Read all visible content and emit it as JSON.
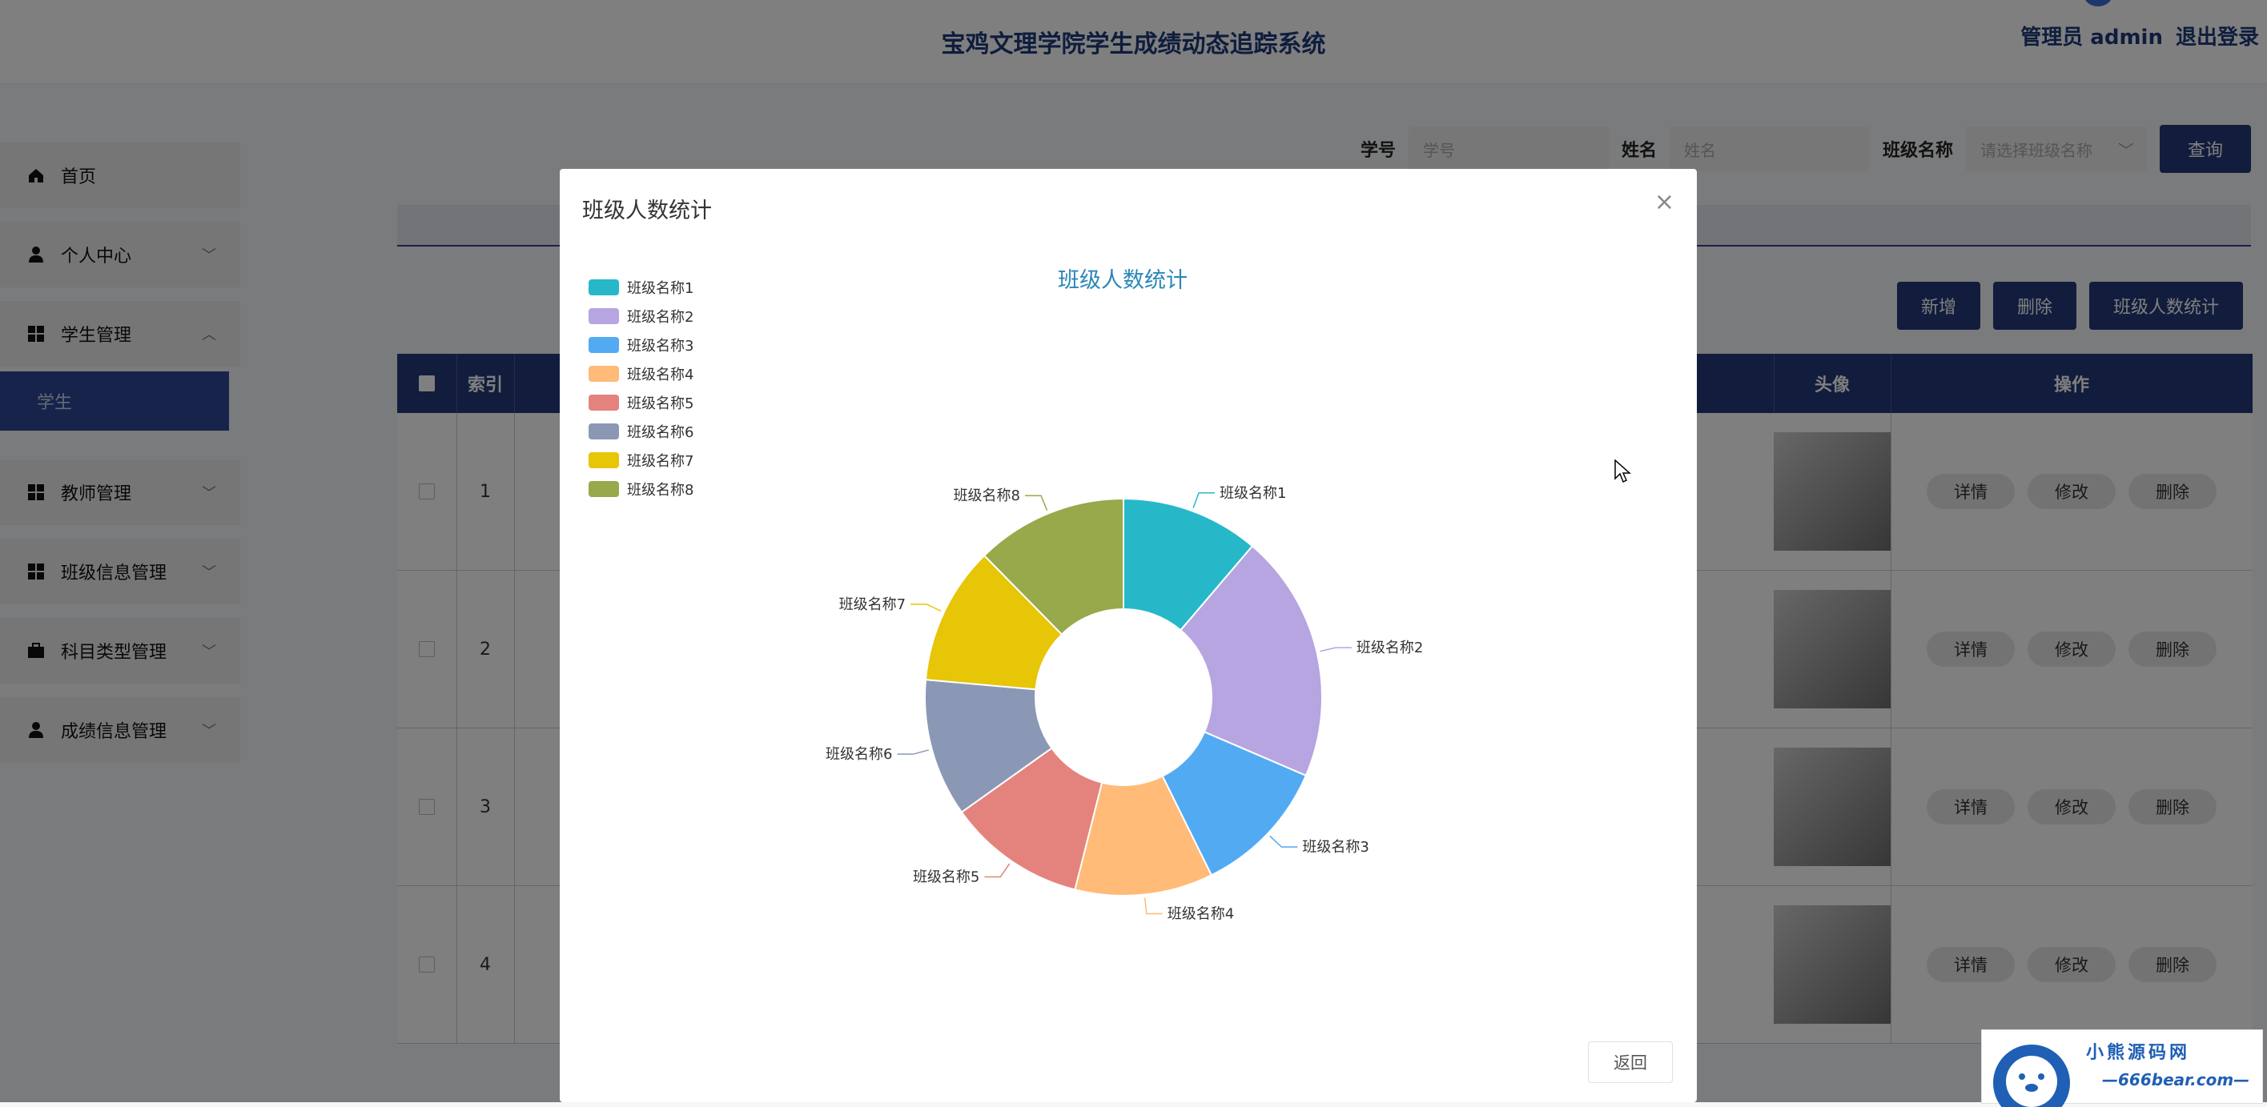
{
  "header": {
    "title": "宝鸡文理学院学生成绩动态追踪系统",
    "admin": "管理员 admin",
    "logout": "退出登录"
  },
  "sidebar": {
    "items": [
      {
        "label": "首页",
        "icon": "home-icon"
      },
      {
        "label": "个人中心",
        "icon": "user-icon"
      },
      {
        "label": "学生管理",
        "icon": "grid-icon"
      },
      {
        "label": "教师管理",
        "icon": "grid-icon"
      },
      {
        "label": "班级信息管理",
        "icon": "grid-icon"
      },
      {
        "label": "科目类型管理",
        "icon": "briefcase-icon"
      },
      {
        "label": "成绩信息管理",
        "icon": "user-icon"
      }
    ],
    "active_sub": "学生"
  },
  "search": {
    "student_id_label": "学号",
    "student_id_placeholder": "学号",
    "name_label": "姓名",
    "name_placeholder": "姓名",
    "class_label": "班级名称",
    "class_placeholder": "请选择班级名称",
    "query": "查询"
  },
  "actions": {
    "add": "新增",
    "delete": "删除",
    "stats": "班级人数统计"
  },
  "table": {
    "headers": {
      "index": "索引",
      "avatar": "头像",
      "ops": "操作"
    },
    "rows": [
      {
        "index": "1"
      },
      {
        "index": "2"
      },
      {
        "index": "3"
      },
      {
        "index": "4"
      }
    ],
    "ops": {
      "detail": "详情",
      "edit": "修改",
      "delete": "删除"
    }
  },
  "modal": {
    "title": "班级人数统计",
    "return": "返回"
  },
  "chart_data": {
    "type": "pie",
    "title": "班级人数统计",
    "donut": true,
    "legend": "top-left",
    "categories": [
      "班级名称1",
      "班级名称2",
      "班级名称3",
      "班级名称4",
      "班级名称5",
      "班级名称6",
      "班级名称7",
      "班级名称8"
    ],
    "values": [
      10,
      18,
      10,
      10,
      10,
      10,
      10,
      11
    ],
    "colors": [
      "#26b8c9",
      "#b6a5e0",
      "#52aaf3",
      "#ffbb77",
      "#e4837d",
      "#8b98b5",
      "#e7c507",
      "#97a94b"
    ]
  },
  "watermark": {
    "line1": "小熊源码网",
    "line2": "—666bear.com—"
  }
}
